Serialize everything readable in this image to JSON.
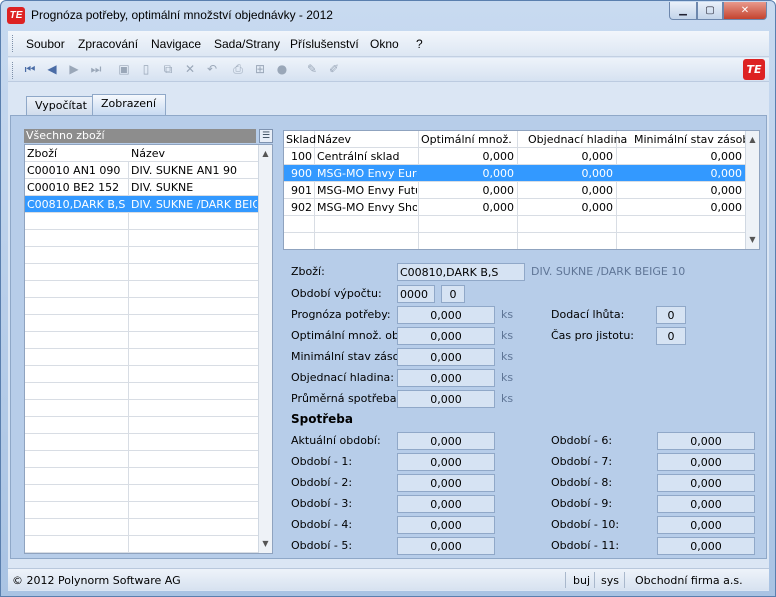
{
  "window": {
    "title": "Prognóza potřeby, optimální množství objednávky - 2012",
    "logo_text": "TE"
  },
  "menu": [
    "Soubor",
    "Zpracování",
    "Navigace",
    "Sada/Strany",
    "Příslušenství",
    "Okno",
    "?"
  ],
  "tabs": [
    "Vypočítat",
    "Zobrazení"
  ],
  "left_list": {
    "header": "Všechno zboží",
    "columns": [
      "Zboží",
      "Název"
    ],
    "rows": [
      [
        "C00010 AN1 090",
        "DIV. SUKNE AN1 90"
      ],
      [
        "C00010 BE2 152",
        "DIV. SUKNE"
      ],
      [
        "C00810,DARK B,S",
        "DIV. SUKNE /DARK BEIGE"
      ]
    ],
    "selected_index": 2
  },
  "warehouse_table": {
    "columns": [
      "Sklad",
      "Název",
      "Optimální množ. obj.",
      "Objednací hladina",
      "Minimální stav zásob"
    ],
    "rows": [
      [
        "100",
        "Centrální sklad",
        "0,000",
        "0,000",
        "0,000"
      ],
      [
        "900",
        "MSG-MO Envy Europ",
        "0,000",
        "0,000",
        "0,000"
      ],
      [
        "901",
        "MSG-MO Envy Futuru",
        "0,000",
        "0,000",
        "0,000"
      ],
      [
        "902",
        "MSG-MO Envy Shopp",
        "0,000",
        "0,000",
        "0,000"
      ]
    ],
    "selected_index": 1
  },
  "detail": {
    "zbozi_label": "Zboží:",
    "zbozi_value": "C00810,DARK B,S",
    "zbozi_desc": "DIV. SUKNE /DARK BEIGE 10",
    "obdobi_label": "Období výpočtu:",
    "obdobi_value1": "0000",
    "obdobi_value2": "0",
    "unit": "ks",
    "left_fields": [
      {
        "label": "Prognóza potřeby:",
        "value": "0,000"
      },
      {
        "label": "Optimální množ. obj.:",
        "value": "0,000"
      },
      {
        "label": "Minimální stav zásob:",
        "value": "0,000"
      },
      {
        "label": "Objednací hladina:",
        "value": "0,000"
      },
      {
        "label": "Průměrná spotřeba:",
        "value": "0,000"
      }
    ],
    "right_fields": [
      {
        "label": "Dodací lhůta:",
        "value": "0"
      },
      {
        "label": "Čas pro jistotu:",
        "value": "0"
      }
    ]
  },
  "consumption": {
    "title": "Spotřeba",
    "left": [
      {
        "label": "Aktuální období:",
        "value": "0,000"
      },
      {
        "label": "Období - 1:",
        "value": "0,000"
      },
      {
        "label": "Období - 2:",
        "value": "0,000"
      },
      {
        "label": "Období - 3:",
        "value": "0,000"
      },
      {
        "label": "Období - 4:",
        "value": "0,000"
      },
      {
        "label": "Období - 5:",
        "value": "0,000"
      }
    ],
    "right": [
      {
        "label": "Období - 6:",
        "value": "0,000"
      },
      {
        "label": "Období - 7:",
        "value": "0,000"
      },
      {
        "label": "Období - 8:",
        "value": "0,000"
      },
      {
        "label": "Období - 9:",
        "value": "0,000"
      },
      {
        "label": "Období - 10:",
        "value": "0,000"
      },
      {
        "label": "Období - 11:",
        "value": "0,000"
      }
    ]
  },
  "status": {
    "copyright": "© 2012 Polynorm Software AG",
    "user": "buj",
    "db": "sys",
    "company": "Obchodní firma a.s."
  }
}
